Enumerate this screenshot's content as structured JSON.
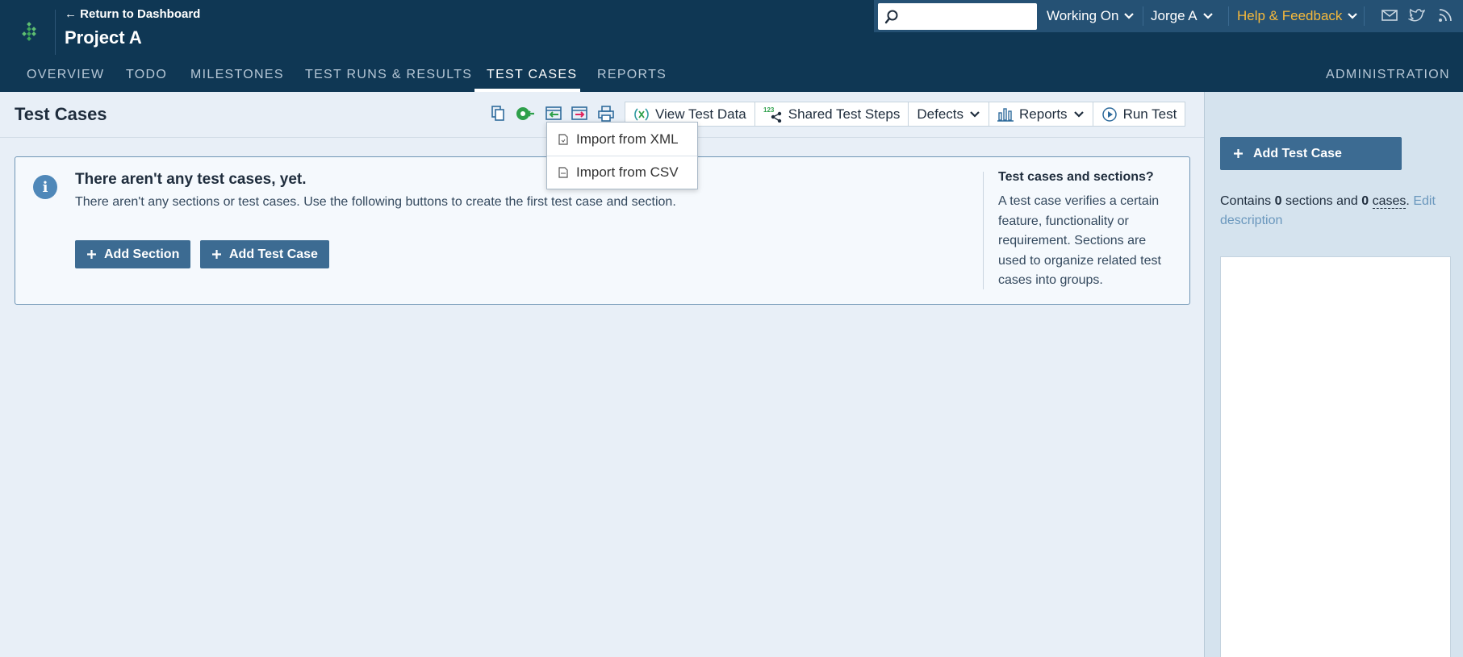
{
  "header": {
    "return_label": "← Return to Dashboard",
    "project_name": "Project A",
    "search_placeholder": "",
    "working_on": "Working On",
    "user": "Jorge A",
    "help": "Help & Feedback",
    "help_color": "#f6b93b",
    "bg_color": "#0f3754"
  },
  "nav": {
    "tabs": [
      "OVERVIEW",
      "TODO",
      "MILESTONES",
      "TEST RUNS & RESULTS",
      "TEST CASES",
      "REPORTS"
    ],
    "active": "TEST CASES",
    "admin": "ADMINISTRATION"
  },
  "toolbar": {
    "page_title": "Test Cases",
    "view_test_data": "View Test Data",
    "shared_test_steps": "Shared Test Steps",
    "defects": "Defects",
    "reports": "Reports",
    "run_test": "Run Test",
    "shared_steps_badge": "123"
  },
  "import_menu": {
    "items": [
      "Import from XML",
      "Import from CSV"
    ]
  },
  "empty_panel": {
    "heading": "There aren't any test cases, yet.",
    "text": "There aren't any sections or test cases. Use the following buttons to create the first test case and section.",
    "add_section": "Add Section",
    "add_test_case": "Add Test Case",
    "side_heading": "Test cases and sections?",
    "side_text": "A test case verifies a certain feature, functionality or requirement. Sections are used to organize related test cases into groups."
  },
  "sidebar": {
    "add_test_case": "Add Test Case",
    "contains": "Contains",
    "sections_count": "0",
    "sections_word": "sections and",
    "cases_count": "0",
    "cases_word": "cases",
    "period": ".",
    "edit_description": "Edit description"
  }
}
